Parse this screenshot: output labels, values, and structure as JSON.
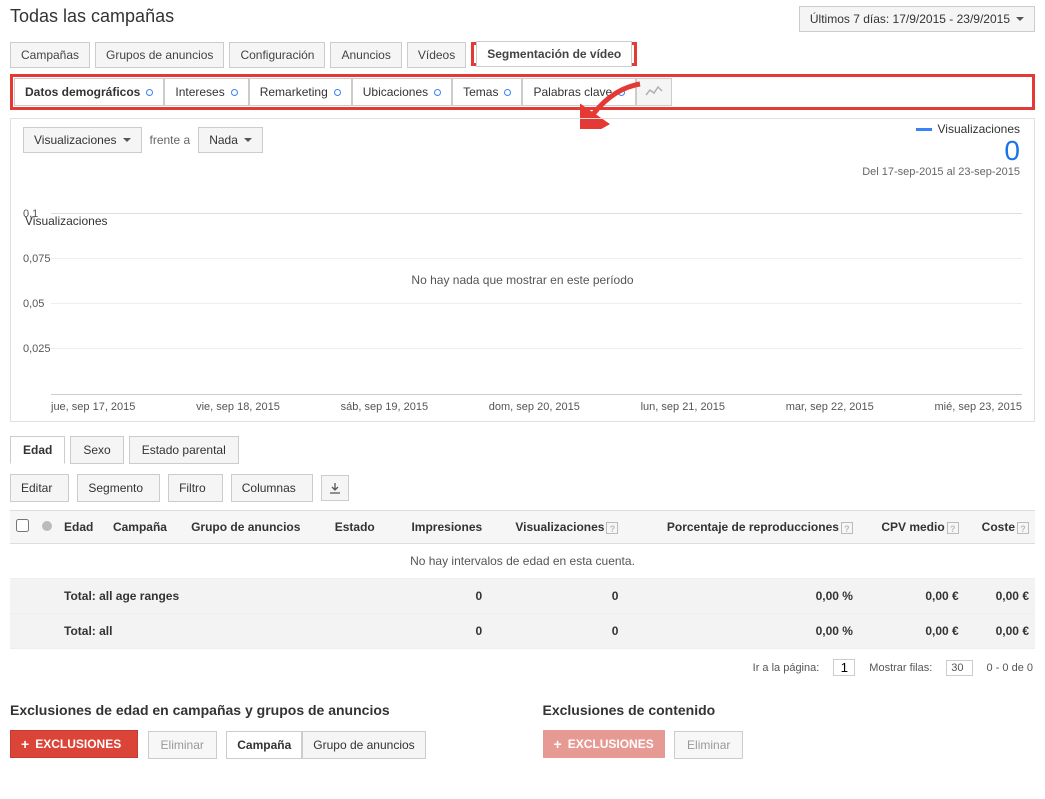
{
  "header": {
    "title": "Todas las campañas",
    "date_range": "Últimos 7 días: 17/9/2015 - 23/9/2015"
  },
  "tabs1": {
    "campanas": "Campañas",
    "grupos": "Grupos de anuncios",
    "config": "Configuración",
    "anuncios": "Anuncios",
    "videos": "Vídeos",
    "seg_video": "Segmentación de vídeo"
  },
  "subtabs": {
    "demo": "Datos demográficos",
    "intereses": "Intereses",
    "remarketing": "Remarketing",
    "ubic": "Ubicaciones",
    "temas": "Temas",
    "palabras": "Palabras clave"
  },
  "chart": {
    "metric_dd": "Visualizaciones",
    "vs": "frente a",
    "compare_dd": "Nada",
    "legend_title": "Visualizaciones",
    "legend_value": "0",
    "period": "Del 17-sep-2015 al 23-sep-2015",
    "yaxis_title": "Visualizaciones",
    "no_data": "No hay nada que mostrar en este período"
  },
  "chart_data": {
    "type": "line",
    "title": "Visualizaciones",
    "ylabel": "Visualizaciones",
    "ylim": [
      0,
      0.1
    ],
    "y_ticks": [
      "0,1",
      "0,075",
      "0,05",
      "0,025"
    ],
    "categories": [
      "jue, sep 17, 2015",
      "vie, sep 18, 2015",
      "sáb, sep 19, 2015",
      "dom, sep 20, 2015",
      "lun, sep 21, 2015",
      "mar, sep 22, 2015",
      "mié, sep 23, 2015"
    ],
    "values": [],
    "empty_message": "No hay nada que mostrar en este período"
  },
  "tabs2": {
    "edad": "Edad",
    "sexo": "Sexo",
    "estado": "Estado parental"
  },
  "toolbar": {
    "editar": "Editar",
    "segmento": "Segmento",
    "filtro": "Filtro",
    "columnas": "Columnas"
  },
  "table": {
    "headers": {
      "edad": "Edad",
      "campana": "Campaña",
      "grupo": "Grupo de anuncios",
      "estado": "Estado",
      "impresiones": "Impresiones",
      "visual": "Visualizaciones",
      "porc": "Porcentaje de reproducciones",
      "cpv": "CPV medio",
      "coste": "Coste"
    },
    "empty": "No hay intervalos de edad en esta cuenta.",
    "totals": [
      {
        "label": "Total: all age ranges",
        "impresiones": "0",
        "visual": "0",
        "porc": "0,00 %",
        "cpv": "0,00 €",
        "coste": "0,00 €"
      },
      {
        "label": "Total: all",
        "impresiones": "0",
        "visual": "0",
        "porc": "0,00 %",
        "cpv": "0,00 €",
        "coste": "0,00 €"
      }
    ]
  },
  "pager": {
    "goto": "Ir a la página:",
    "page": "1",
    "show": "Mostrar filas:",
    "rows": "30",
    "range": "0 - 0 de 0"
  },
  "bottom": {
    "left_title": "Exclusiones de edad en campañas y grupos de anuncios",
    "right_title": "Exclusiones de contenido",
    "exclusiones": "EXCLUSIONES",
    "eliminar": "Eliminar",
    "campana": "Campaña",
    "grupo": "Grupo de anuncios"
  }
}
